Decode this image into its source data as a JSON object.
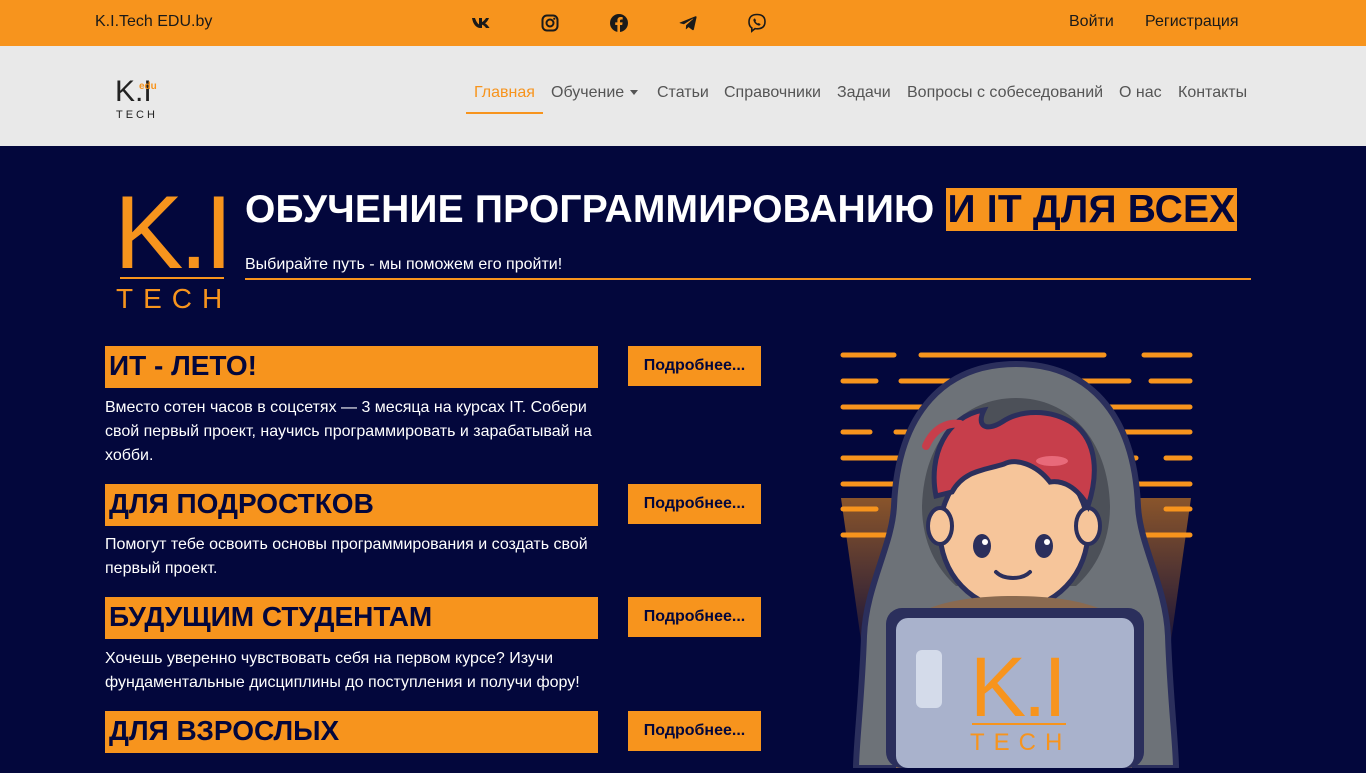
{
  "topbar": {
    "brand": "K.I.Tech EDU.by",
    "socials": [
      {
        "icon": "vk-icon"
      },
      {
        "icon": "instagram-icon"
      },
      {
        "icon": "facebook-icon"
      },
      {
        "icon": "telegram-icon"
      },
      {
        "icon": "viber-icon"
      }
    ],
    "login": "Войти",
    "register": "Регистрация"
  },
  "nav": {
    "items": [
      {
        "label": "Главная",
        "active": true
      },
      {
        "label": "Обучение",
        "dropdown": true
      },
      {
        "label": "Статьи"
      },
      {
        "label": "Справочники"
      },
      {
        "label": "Задачи"
      },
      {
        "label": "Вопросы с собеседований"
      },
      {
        "label": "О нас"
      },
      {
        "label": "Контакты"
      }
    ]
  },
  "hero": {
    "title_main": "ОБУЧЕНИЕ ПРОГРАММИРОВАНИЮ",
    "title_highlight": "И IT ДЛЯ ВСЕХ",
    "subtitle": "Выбирайте путь - мы поможем его пройти!"
  },
  "logo": {
    "letters": "K.I",
    "sub": "TECH",
    "badge": "edu"
  },
  "cards": [
    {
      "title": "ИТ - ЛЕТО!",
      "button": "Подробнее...",
      "text": "Вместо сотен часов в соцсетях — 3 месяца на курсах IT. Собери свой первый проект, научись программировать и зарабатывай на хобби."
    },
    {
      "title": "ДЛЯ ПОДРОСТКОВ",
      "button": "Подробнее...",
      "text": "Помогут тебе освоить основы программирования и создать свой первый проект."
    },
    {
      "title": "БУДУЩИМ СТУДЕНТАМ",
      "button": "Подробнее...",
      "text": "Хочешь уверенно чувствовать себя на первом курсе? Изучи фундаментальные дисциплины до поступления и получи фору!"
    },
    {
      "title": "ДЛЯ ВЗРОСЛЫХ",
      "button": "Подробнее...",
      "text": ""
    }
  ],
  "colors": {
    "accent": "#f7941d",
    "background": "#03073c",
    "navbar": "#e9e9e9"
  }
}
